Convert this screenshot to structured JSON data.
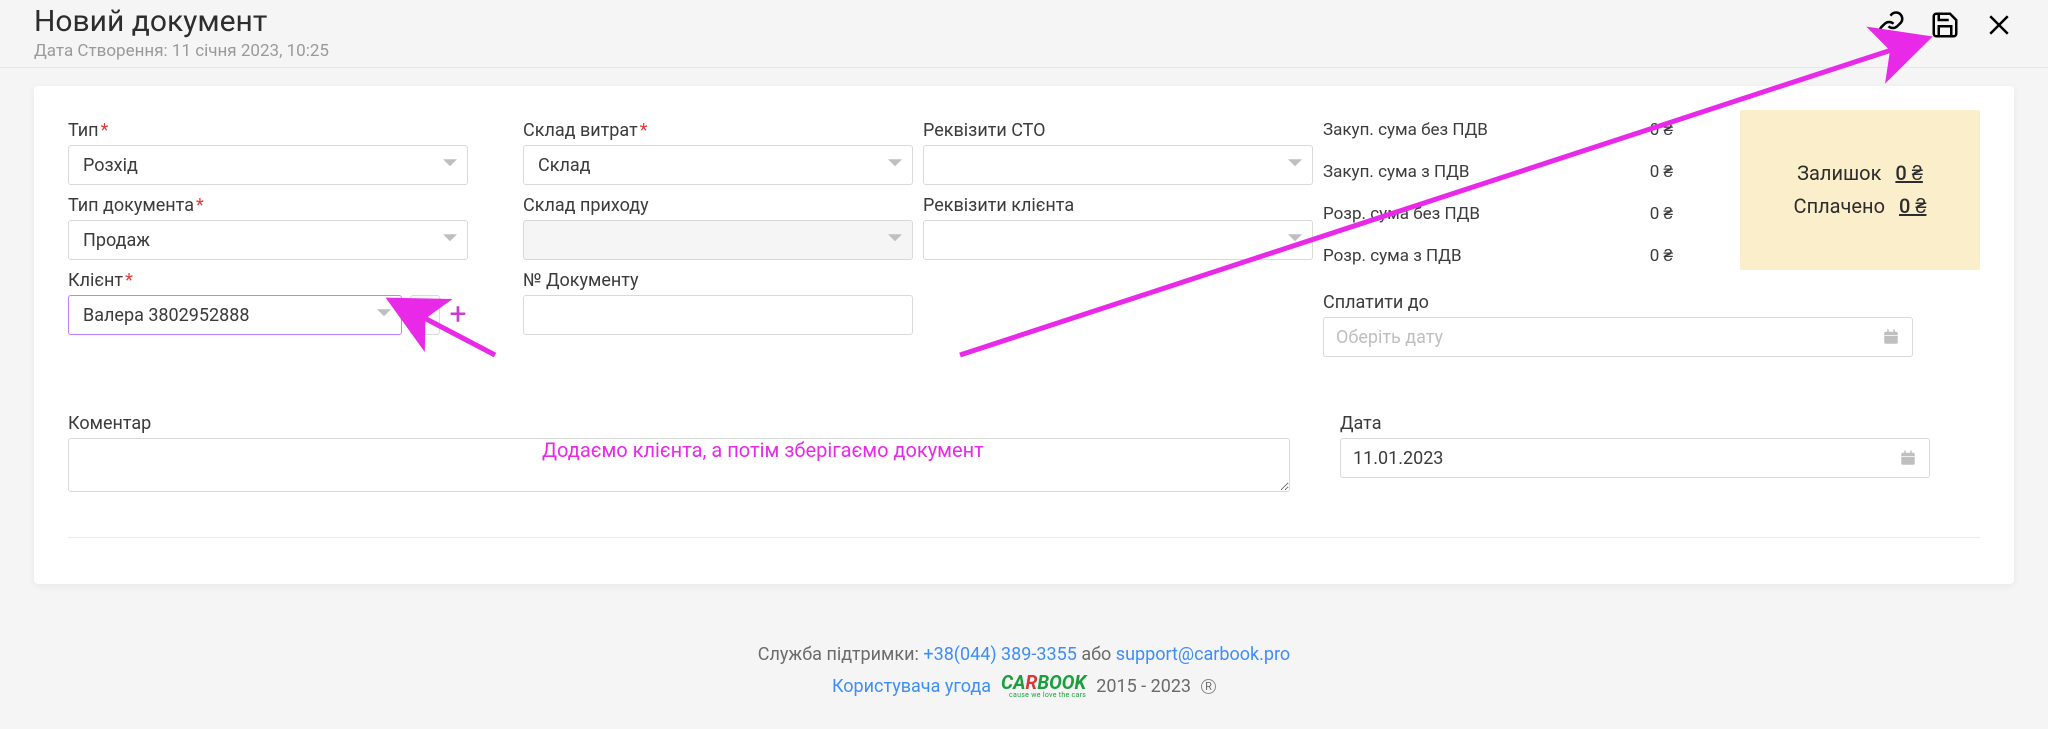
{
  "header": {
    "title": "Новий документ",
    "subtitle": "Дата Створення: 11 січня 2023, 10:25"
  },
  "labels": {
    "type": "Тип",
    "docType": "Тип документа",
    "client": "Клієнт",
    "expenseWarehouse": "Склад витрат",
    "incomeWarehouse": "Склад приходу",
    "docNumber": "№ Документу",
    "stoRequisites": "Реквізити СТО",
    "clientRequisites": "Реквізити клієнта",
    "payUntil": "Сплатити до",
    "comment": "Коментар",
    "date": "Дата"
  },
  "values": {
    "type": "Розхід",
    "docType": "Продаж",
    "client": "Валера 3802952888",
    "expenseWarehouse": "Склад",
    "incomeWarehouse": "",
    "docNumber": "",
    "stoRequisites": "",
    "clientRequisites": "",
    "payUntilPlaceholder": "Оберіть дату",
    "date": "11.01.2023",
    "comment": ""
  },
  "summary": {
    "rows": [
      {
        "label": "Закуп. сума без ПДВ",
        "value": "0 ₴"
      },
      {
        "label": "Закуп. сума з ПДВ",
        "value": "0 ₴"
      },
      {
        "label": "Розр. сума без ПДВ",
        "value": "0 ₴"
      },
      {
        "label": "Розр. сума з ПДВ",
        "value": "0 ₴"
      }
    ],
    "status": {
      "remainderLabel": "Залишок",
      "remainderValue": "0 ₴",
      "paidLabel": "Сплачено",
      "paidValue": "0 ₴"
    }
  },
  "annotation": {
    "text": "Додаємо клієнта, а потім зберігаємо документ"
  },
  "footer": {
    "supportLabel": "Служба підтримки:",
    "phone": "+38(044) 389-3355",
    "or": "або",
    "email": "support@carbook.pro",
    "agreement": "Користувача угода",
    "years": "2015 - 2023",
    "logoTag": "cause we love the cars"
  }
}
